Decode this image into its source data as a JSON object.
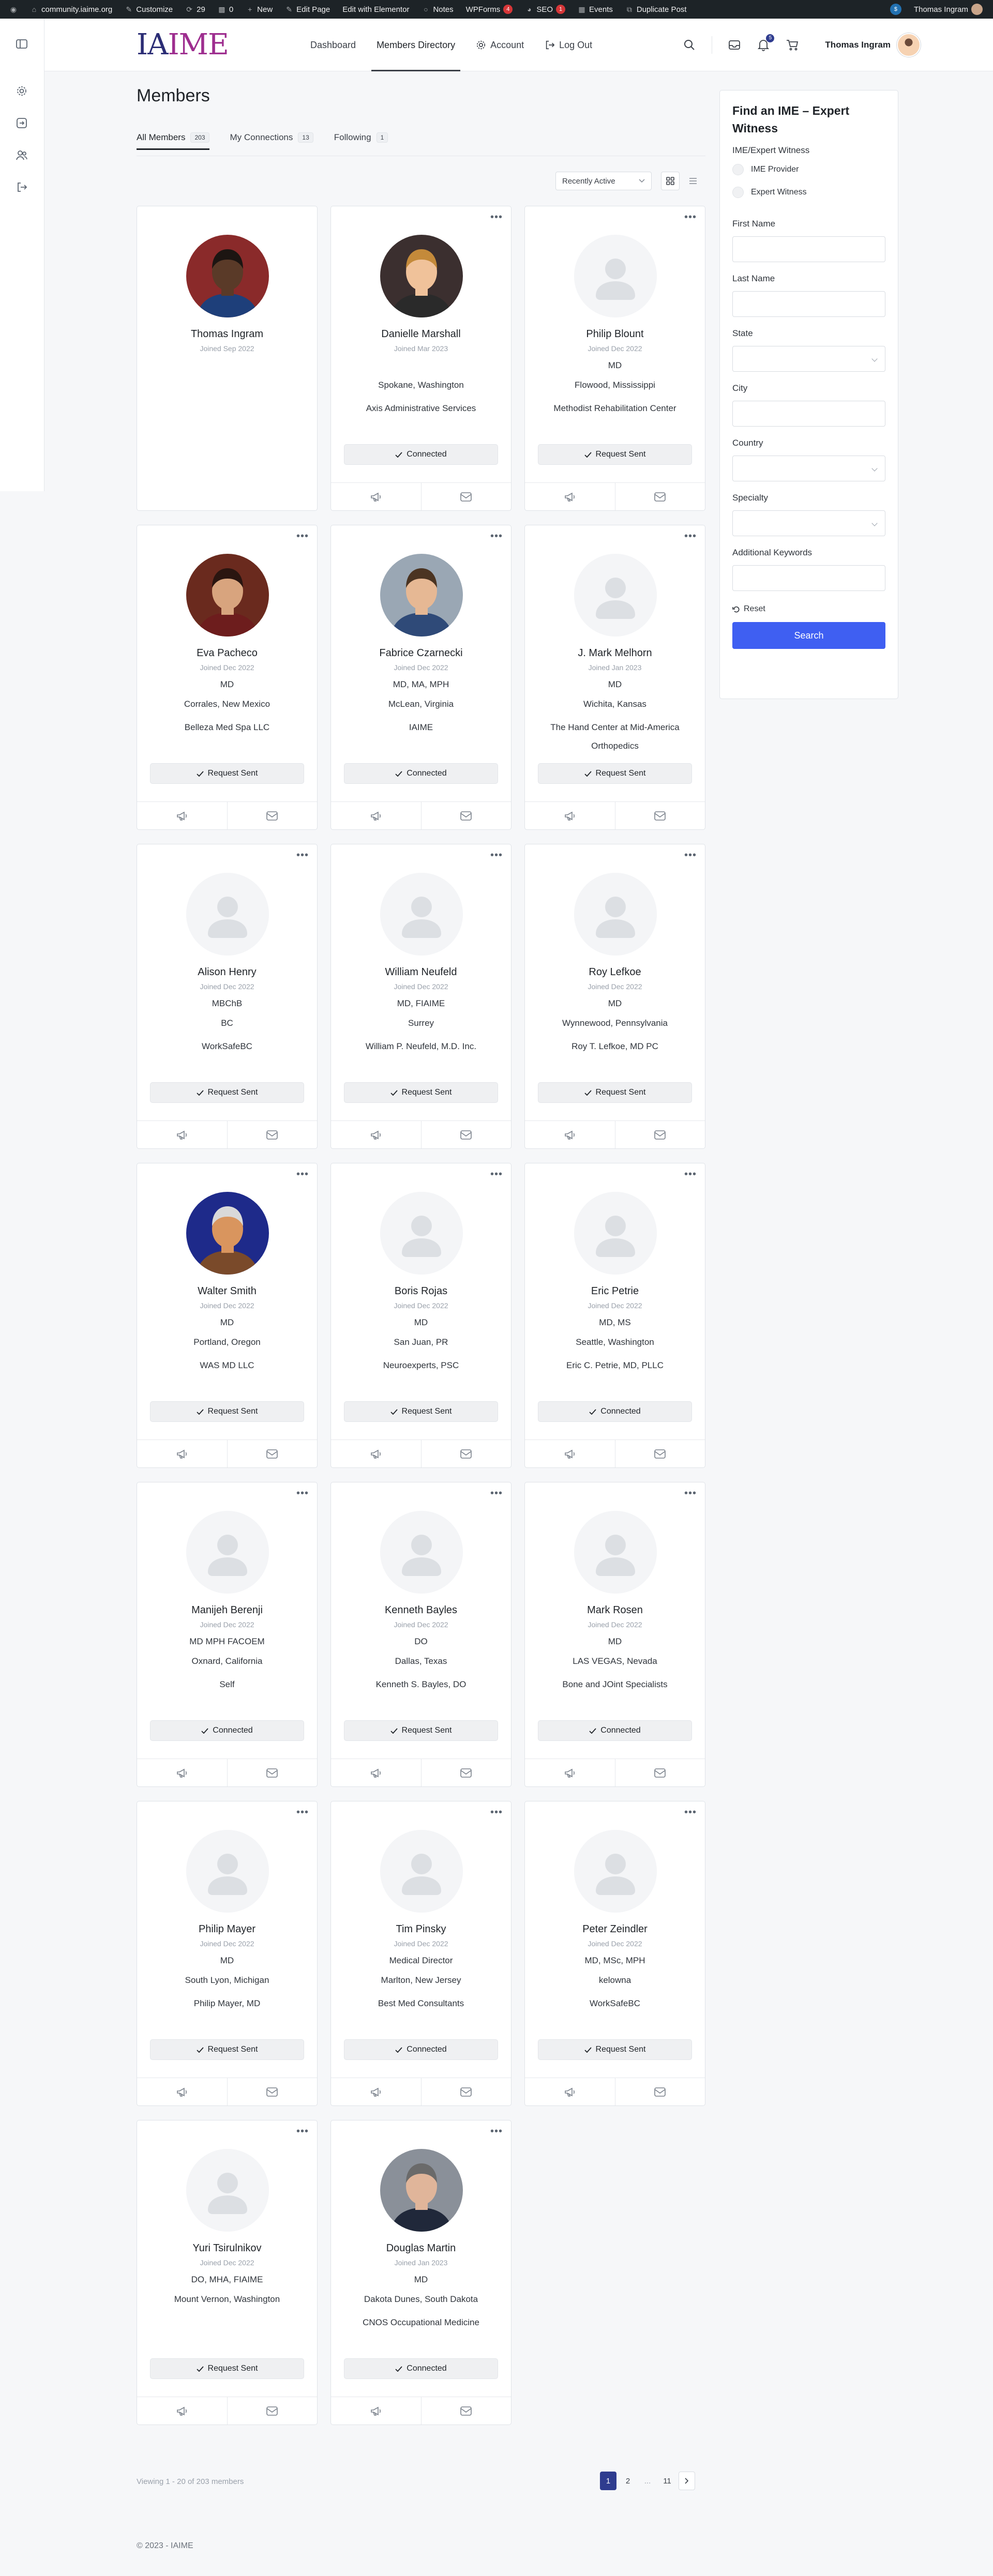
{
  "adminbar": {
    "site": "community.iaime.org",
    "customize": "Customize",
    "updates": "29",
    "comments": "0",
    "new": "New",
    "edit_page": "Edit Page",
    "edit_elementor": "Edit with Elementor",
    "notes": "Notes",
    "wpforms": "WPForms",
    "wpforms_badge": "4",
    "seo": "SEO",
    "seo_badge": "1",
    "events": "Events",
    "duplicate": "Duplicate Post",
    "howdy": "Thomas Ingram"
  },
  "header": {
    "logo_a": "IA",
    "logo_b": "IME",
    "nav": [
      "Dashboard",
      "Members Directory",
      "Account",
      "Log Out"
    ],
    "notif_count": "5",
    "user_name": "Thomas Ingram"
  },
  "page": {
    "title": "Members",
    "tabs": [
      {
        "label": "All Members",
        "count": "203"
      },
      {
        "label": "My Connections",
        "count": "13"
      },
      {
        "label": "Following",
        "count": "1"
      }
    ],
    "sort": "Recently Active"
  },
  "members": [
    {
      "name": "Thomas Ingram",
      "joined": "Joined Sep 2022",
      "l1": "",
      "l2": "",
      "l3": "",
      "status": "",
      "photo": "p1"
    },
    {
      "name": "Danielle Marshall",
      "joined": "Joined Mar 2023",
      "l1": "",
      "l2": "Spokane, Washington",
      "l3": "Axis Administrative Services",
      "status": "Connected",
      "photo": "p2"
    },
    {
      "name": "Philip Blount",
      "joined": "Joined Dec 2022",
      "l1": "MD",
      "l2": "Flowood, Mississippi",
      "l3": "Methodist Rehabilitation Center",
      "status": "Request Sent",
      "photo": ""
    },
    {
      "name": "Eva Pacheco",
      "joined": "Joined Dec 2022",
      "l1": "MD",
      "l2": "Corrales, New Mexico",
      "l3": "Belleza Med Spa LLC",
      "status": "Request Sent",
      "photo": "p3"
    },
    {
      "name": "Fabrice Czarnecki",
      "joined": "Joined Dec 2022",
      "l1": "MD, MA, MPH",
      "l2": "McLean, Virginia",
      "l3": "IAIME",
      "status": "Connected",
      "photo": "p4"
    },
    {
      "name": "J. Mark Melhorn",
      "joined": "Joined Jan 2023",
      "l1": "MD",
      "l2": "Wichita, Kansas",
      "l3": "The Hand Center at Mid-America Orthopedics",
      "status": "Request Sent",
      "photo": ""
    },
    {
      "name": "Alison Henry",
      "joined": "Joined Dec 2022",
      "l1": "MBChB",
      "l2": "BC",
      "l3": "WorkSafeBC",
      "status": "Request Sent",
      "photo": ""
    },
    {
      "name": "William Neufeld",
      "joined": "Joined Dec 2022",
      "l1": "MD, FIAIME",
      "l2": "Surrey",
      "l3": "William P. Neufeld, M.D. Inc.",
      "status": "Request Sent",
      "photo": ""
    },
    {
      "name": "Roy Lefkoe",
      "joined": "Joined Dec 2022",
      "l1": "MD",
      "l2": "Wynnewood, Pennsylvania",
      "l3": "Roy T. Lefkoe, MD PC",
      "status": "Request Sent",
      "photo": ""
    },
    {
      "name": "Walter Smith",
      "joined": "Joined Dec 2022",
      "l1": "MD",
      "l2": "Portland, Oregon",
      "l3": "WAS MD LLC",
      "status": "Request Sent",
      "photo": "p5"
    },
    {
      "name": "Boris Rojas",
      "joined": "Joined Dec 2022",
      "l1": "MD",
      "l2": "San Juan, PR",
      "l3": "Neuroexperts, PSC",
      "status": "Request Sent",
      "photo": ""
    },
    {
      "name": "Eric Petrie",
      "joined": "Joined Dec 2022",
      "l1": "MD, MS",
      "l2": "Seattle, Washington",
      "l3": "Eric C. Petrie, MD, PLLC",
      "status": "Connected",
      "photo": ""
    },
    {
      "name": "Manijeh Berenji",
      "joined": "Joined Dec 2022",
      "l1": "MD MPH FACOEM",
      "l2": "Oxnard, California",
      "l3": "Self",
      "status": "Connected",
      "photo": ""
    },
    {
      "name": "Kenneth Bayles",
      "joined": "Joined Dec 2022",
      "l1": "DO",
      "l2": "Dallas, Texas",
      "l3": "Kenneth S. Bayles, DO",
      "status": "Request Sent",
      "photo": ""
    },
    {
      "name": "Mark Rosen",
      "joined": "Joined Dec 2022",
      "l1": "MD",
      "l2": "LAS VEGAS, Nevada",
      "l3": "Bone and JOint Specialists",
      "status": "Connected",
      "photo": ""
    },
    {
      "name": "Philip Mayer",
      "joined": "Joined Dec 2022",
      "l1": "MD",
      "l2": "South Lyon, Michigan",
      "l3": "Philip Mayer, MD",
      "status": "Request Sent",
      "photo": ""
    },
    {
      "name": "Tim Pinsky",
      "joined": "Joined Dec 2022",
      "l1": "Medical Director",
      "l2": "Marlton, New Jersey",
      "l3": "Best Med Consultants",
      "status": "Connected",
      "photo": ""
    },
    {
      "name": "Peter Zeindler",
      "joined": "Joined Dec 2022",
      "l1": "MD, MSc, MPH",
      "l2": "kelowna",
      "l3": "WorkSafeBC",
      "status": "Request Sent",
      "photo": ""
    },
    {
      "name": "Yuri Tsirulnikov",
      "joined": "Joined Dec 2022",
      "l1": "DO, MHA, FIAIME",
      "l2": "Mount Vernon, Washington",
      "l3": "",
      "status": "Request Sent",
      "photo": ""
    },
    {
      "name": "Douglas Martin",
      "joined": "Joined Jan 2023",
      "l1": "MD",
      "l2": "Dakota Dunes, South Dakota",
      "l3": "CNOS Occupational Medicine",
      "status": "Connected",
      "photo": "p6"
    }
  ],
  "sidebar": {
    "title": "Find an IME – Expert Witness",
    "type_label": "IME/Expert Witness",
    "opt1": "IME Provider",
    "opt2": "Expert Witness",
    "first_name": "First Name",
    "last_name": "Last Name",
    "state": "State",
    "city": "City",
    "country": "Country",
    "specialty": "Specialty",
    "keywords": "Additional Keywords",
    "reset": "Reset",
    "search": "Search"
  },
  "pagination": {
    "viewing": "Viewing 1 - 20 of 203 members",
    "pages": [
      "1",
      "2",
      "...",
      "11"
    ]
  },
  "footer": {
    "copyright": "© 2023 - IAIME"
  }
}
